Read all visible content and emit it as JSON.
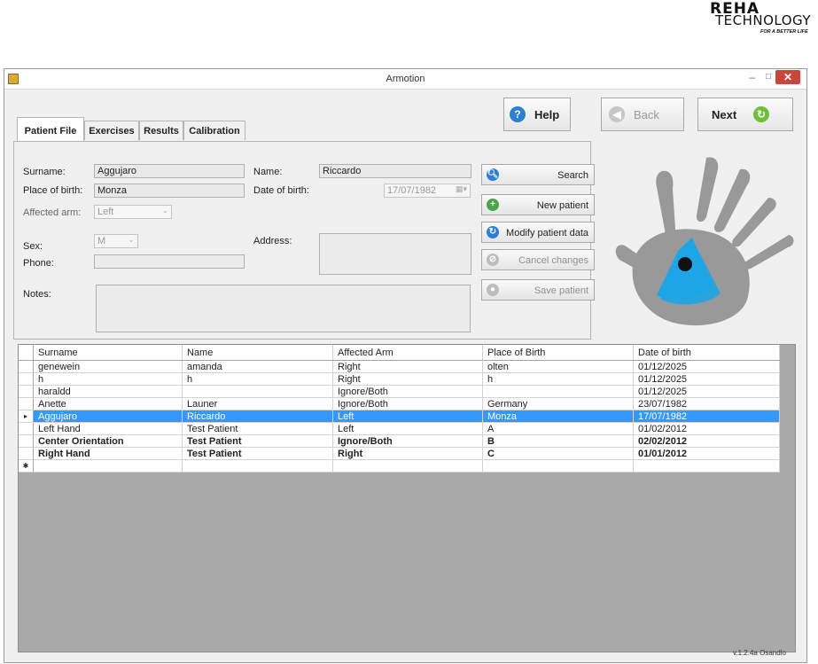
{
  "logo": {
    "line1": "REHA",
    "line2": "TECHNOLOGY",
    "tagline": "FOR A BETTER LIFE"
  },
  "window": {
    "title": "Armotion",
    "minimize": "–",
    "maximize": "□",
    "close": "✕"
  },
  "nav": {
    "help": "Help",
    "back": "Back",
    "next": "Next"
  },
  "tabs": [
    "Patient File",
    "Exercises",
    "Results",
    "Calibration"
  ],
  "form": {
    "surname_label": "Surname:",
    "surname": "Aggujaro",
    "name_label": "Name:",
    "name": "Riccardo",
    "birthplace_label": "Place of birth:",
    "birthplace": "Monza",
    "dob_label": "Date of birth:",
    "dob": "17/07/1982",
    "arm_label": "Affected arm:",
    "arm": "Left",
    "sex_label": "Sex:",
    "sex": "M",
    "address_label": "Address:",
    "phone_label": "Phone:",
    "notes_label": "Notes:"
  },
  "actions": {
    "search": "Search",
    "new_patient": "New patient",
    "modify": "Modify patient data",
    "cancel": "Cancel changes",
    "save": "Save patient"
  },
  "table": {
    "headers": [
      "Surname",
      "Name",
      "Affected Arm",
      "Place of Birth",
      "Date of birth"
    ],
    "rows": [
      [
        "genewein",
        "amanda",
        "Right",
        "olten",
        "01/12/2025"
      ],
      [
        "h",
        "h",
        "Right",
        "h",
        "01/12/2025"
      ],
      [
        "haraldd",
        "",
        "Ignore/Both",
        "",
        "01/12/2025"
      ],
      [
        "Anette",
        "Launer",
        "Ignore/Both",
        "Germany",
        "23/07/1982"
      ],
      [
        "Aggujaro",
        "Riccardo",
        "Left",
        "Monza",
        "17/07/1982"
      ],
      [
        "Left Hand",
        "Test Patient",
        "Left",
        "A",
        "01/02/2012"
      ],
      [
        "Center Orientation",
        "Test Patient",
        "Ignore/Both",
        "B",
        "02/02/2012"
      ],
      [
        "Right Hand",
        "Test Patient",
        "Right",
        "C",
        "01/01/2012"
      ]
    ],
    "current_marker": "▸",
    "new_row_marker": "✱"
  },
  "version": "v.1.2.4a   Osandlo",
  "colors": {
    "selection": "#3399ff",
    "hand_blue": "#1ea5e6",
    "close": "#c9463d"
  }
}
